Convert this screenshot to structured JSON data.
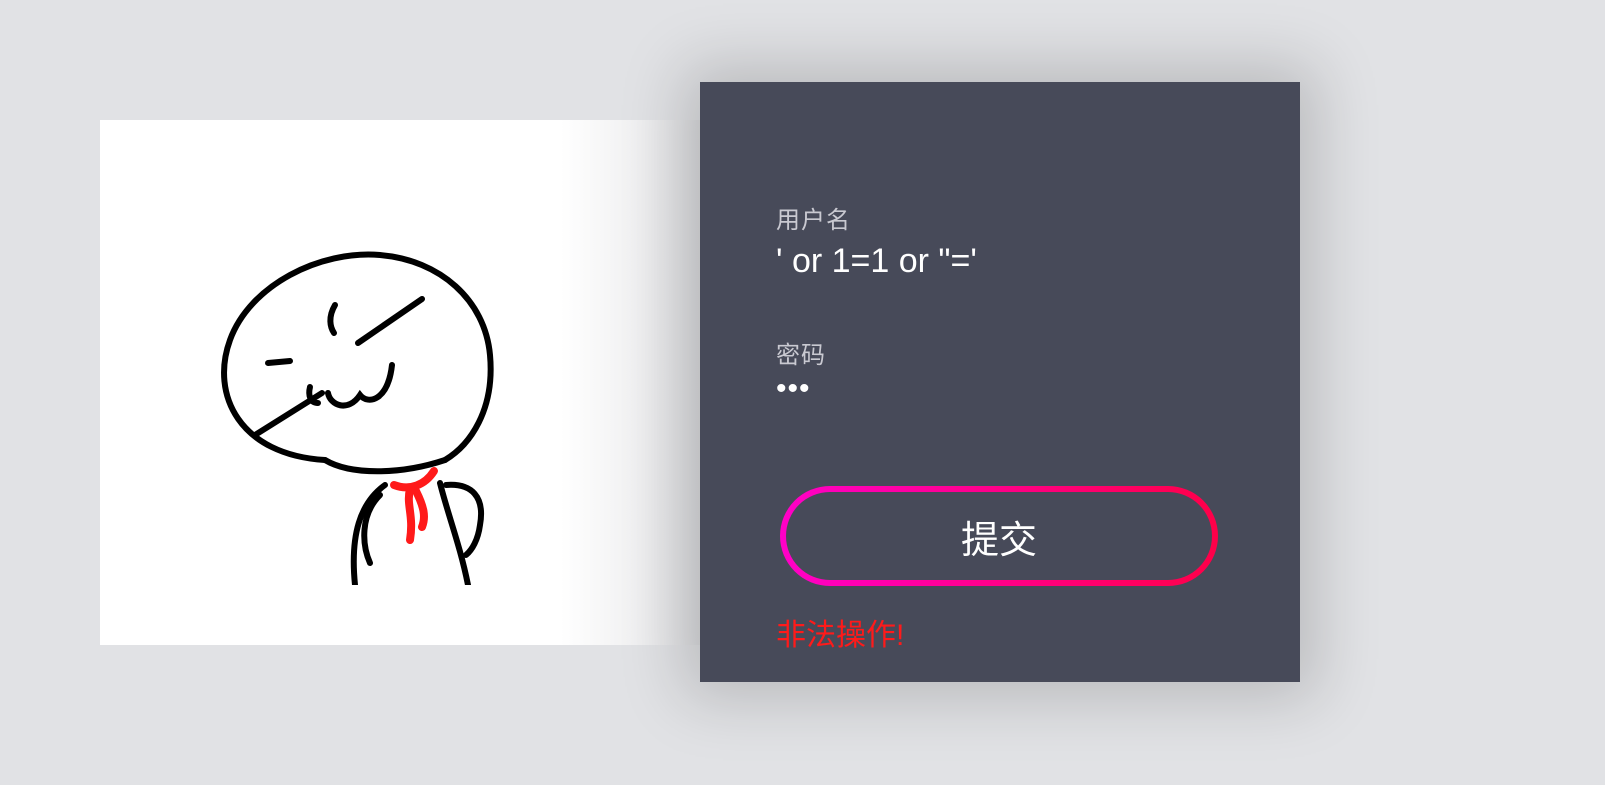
{
  "illustration": {
    "icon": "smirking-stickman-meme",
    "tie_color": "#ff1a1a"
  },
  "form": {
    "username_label": "用户名",
    "username_value": "' or 1=1 or \"='",
    "password_label": "密码",
    "password_value": "•••",
    "submit_label": "提交",
    "error_message": "非法操作!"
  },
  "colors": {
    "page_bg": "#e1e2e5",
    "card_bg": "#474a59",
    "button_gradient_start": "#ff00c8",
    "button_gradient_end": "#ff0048",
    "error_text": "#ff1a1a"
  }
}
